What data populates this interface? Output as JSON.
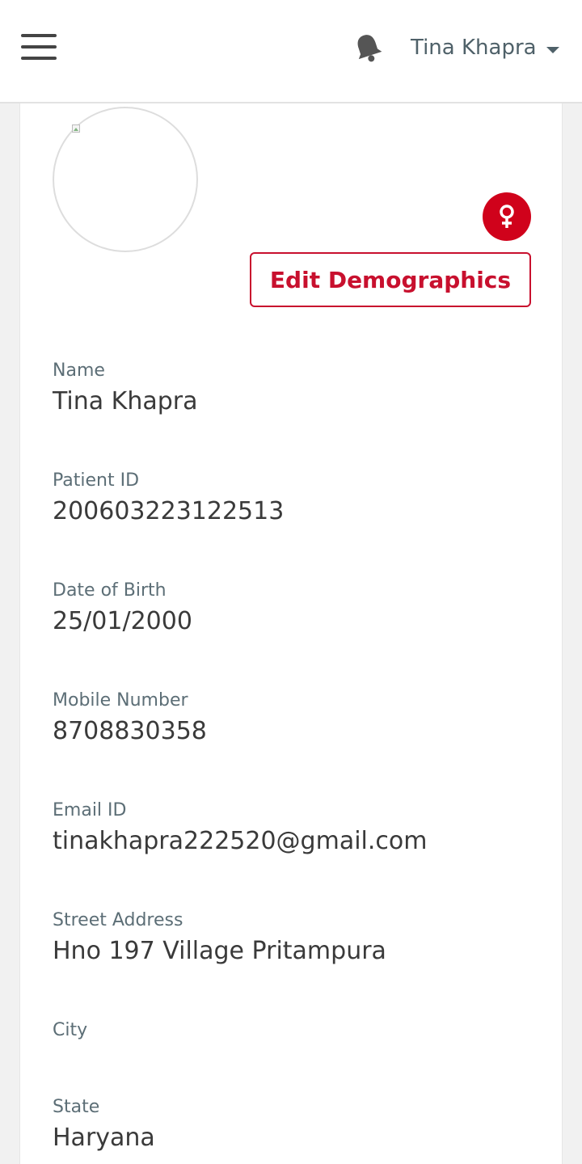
{
  "header": {
    "user_name": "Tina Khapra",
    "menu_icon": "hamburger-icon",
    "notification_icon": "bell-icon",
    "dropdown_icon": "caret-down-icon"
  },
  "profile": {
    "gender_icon": "female-symbol-icon",
    "edit_button_label": "Edit Demographics"
  },
  "fields": {
    "name": {
      "label": "Name",
      "value": "Tina Khapra"
    },
    "patient_id": {
      "label": "Patient ID",
      "value": "200603223122513"
    },
    "dob": {
      "label": "Date of Birth",
      "value": "25/01/2000"
    },
    "mobile": {
      "label": "Mobile Number",
      "value": "8708830358"
    },
    "email": {
      "label": "Email ID",
      "value": "tinakhapra222520@gmail.com"
    },
    "street": {
      "label": "Street Address",
      "value": "Hno 197 Village Pritampura"
    },
    "city": {
      "label": "City",
      "value": ""
    },
    "state": {
      "label": "State",
      "value": "Haryana"
    }
  },
  "colors": {
    "accent": "#c8102e",
    "badge": "#d0021b",
    "label": "#5c6e76",
    "value": "#3a3a3a"
  }
}
